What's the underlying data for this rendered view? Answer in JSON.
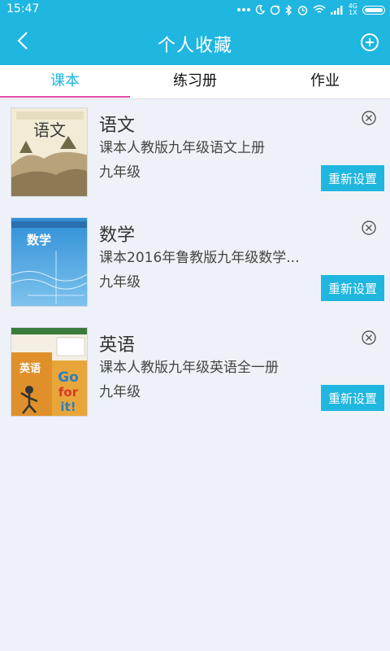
{
  "status_bar": {
    "time": "15:47",
    "network_top": "4G",
    "network_bottom": "1X",
    "icons": [
      "more-dots-icon",
      "moon-icon",
      "sync-icon",
      "bluetooth-icon",
      "alarm-icon",
      "wifi-icon",
      "signal-icon",
      "battery-icon"
    ]
  },
  "header": {
    "title": "个人收藏",
    "back_icon": "chevron-left-icon",
    "add_icon": "plus-circle-icon"
  },
  "tabs": [
    {
      "label": "课本",
      "active": true
    },
    {
      "label": "练习册",
      "active": false
    },
    {
      "label": "作业",
      "active": false
    }
  ],
  "books": [
    {
      "title": "语文",
      "desc": "课本人教版九年级语文上册",
      "grade": "九年级",
      "reset_label": "重新设置",
      "cover_text": "语文"
    },
    {
      "title": "数学",
      "desc": "课本2016年鲁教版九年级数学...",
      "grade": "九年级",
      "reset_label": "重新设置",
      "cover_text": "数学"
    },
    {
      "title": "英语",
      "desc": "课本人教版九年级英语全一册",
      "grade": "九年级",
      "reset_label": "重新设置",
      "cover_text": "英语"
    }
  ],
  "colors": {
    "primary": "#1fb6e0",
    "tab_underline": "#e44aa0",
    "background": "#eef2f8"
  }
}
